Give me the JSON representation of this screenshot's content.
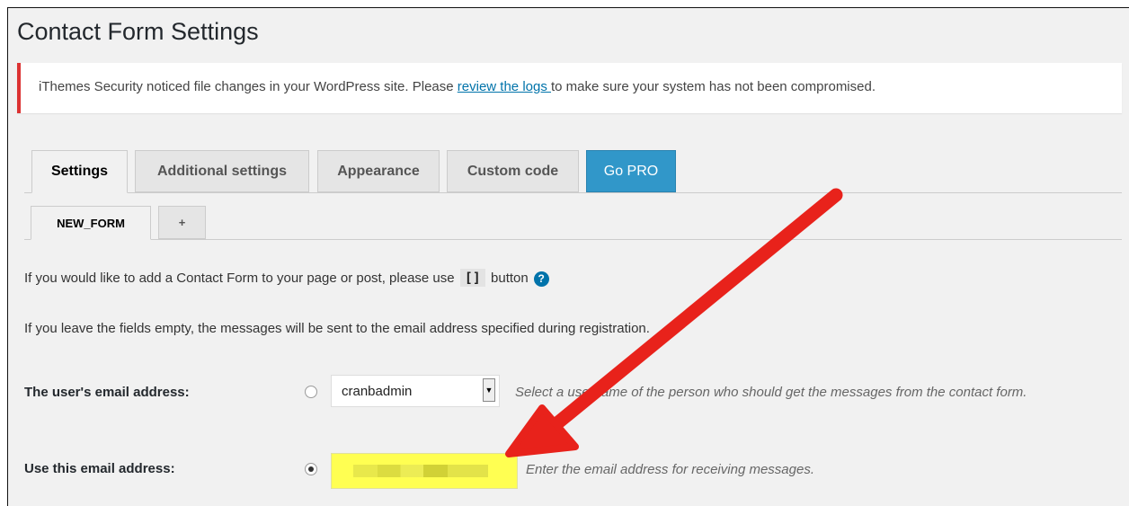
{
  "page": {
    "title": "Contact Form Settings"
  },
  "notice": {
    "text_before": "iThemes Security noticed file changes in your WordPress site. Please ",
    "link_text": "review the logs ",
    "text_after": "to make sure your system has not been compromised.",
    "accent_color": "#dc3232"
  },
  "tabs": [
    {
      "label": "Settings",
      "active": true
    },
    {
      "label": "Additional settings",
      "active": false
    },
    {
      "label": "Appearance",
      "active": false
    },
    {
      "label": "Custom code",
      "active": false
    },
    {
      "label": "Go PRO",
      "active": false
    }
  ],
  "form_tabs": [
    {
      "label": "NEW_FORM",
      "active": true
    },
    {
      "label": "+",
      "active": false
    }
  ],
  "info": {
    "line1_before": "If you would like to add a Contact Form to your page or post, please use ",
    "shortcode_icon": "[]",
    "line1_after": " button",
    "help_icon": "?",
    "line2": "If you leave the fields empty, the messages will be sent to the email address specified during registration."
  },
  "fields": {
    "user_email": {
      "label": "The user's email address:",
      "selected": "cranbadmin",
      "description": "Select a username of the person who should get the messages from the contact form.",
      "checked": false
    },
    "custom_email": {
      "label": "Use this email address:",
      "value": "",
      "description": "Enter the email address for receiving messages.",
      "checked": true,
      "highlight_color": "#ffff52"
    }
  },
  "annotation": {
    "arrow_color": "#e8221b"
  }
}
